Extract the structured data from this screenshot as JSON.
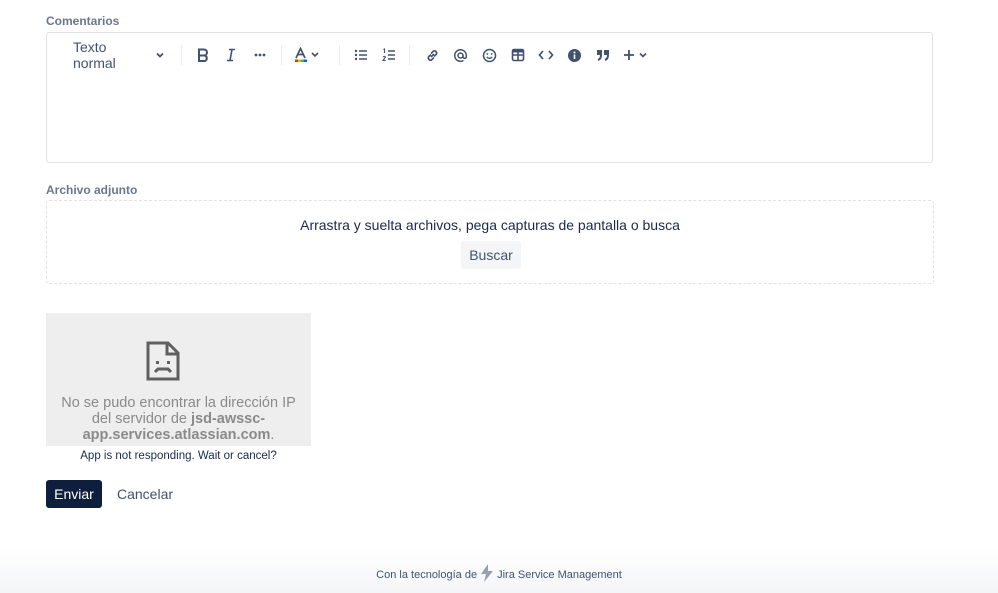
{
  "comments": {
    "label": "Comentarios",
    "toolbar": {
      "text_style": "Texto normal",
      "icons": [
        "bold-icon",
        "italic-icon",
        "more-icon",
        "text-color-icon",
        "bullet-list-icon",
        "numbered-list-icon",
        "link-icon",
        "mention-icon",
        "emoji-icon",
        "table-icon",
        "code-icon",
        "info-icon",
        "quote-icon",
        "insert-plus-icon"
      ]
    }
  },
  "attachment": {
    "label": "Archivo adjunto",
    "drop_text": "Arrastra y suelta archivos, pega capturas de pantalla o busca",
    "browse_label": "Buscar"
  },
  "error_frame": {
    "message_start": "No se pudo encontrar la dirección IP del servidor de",
    "host": "jsd-awssc-app.services.atlassian.com",
    "message_end": ".",
    "not_responding_text": "App is not responding. Wait or",
    "cancel_link": "cancel",
    "question_mark": "?"
  },
  "actions": {
    "submit_label": "Enviar",
    "cancel_label": "Cancelar"
  },
  "footer": {
    "powered_prefix": "Con la tecnología de",
    "product": "Jira Service Management"
  },
  "colors": {
    "primary_button": "#0d1f3d",
    "label": "#6b778c",
    "text_color_underline": "#de350b"
  }
}
